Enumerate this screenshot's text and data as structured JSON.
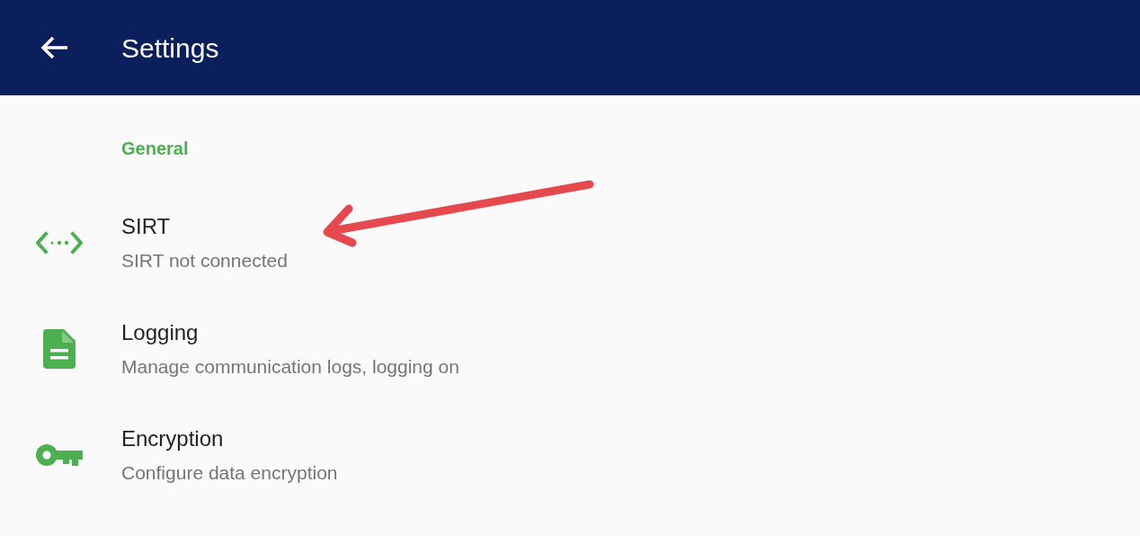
{
  "app_bar": {
    "title": "Settings"
  },
  "section": {
    "label": "General"
  },
  "items": [
    {
      "kind": "code",
      "title": "SIRT",
      "subtitle": "SIRT not connected"
    },
    {
      "kind": "document",
      "title": "Logging",
      "subtitle": "Manage communication logs, logging on"
    },
    {
      "kind": "key",
      "title": "Encryption",
      "subtitle": "Configure data encryption"
    }
  ],
  "annotation": {
    "kind": "arrow"
  }
}
